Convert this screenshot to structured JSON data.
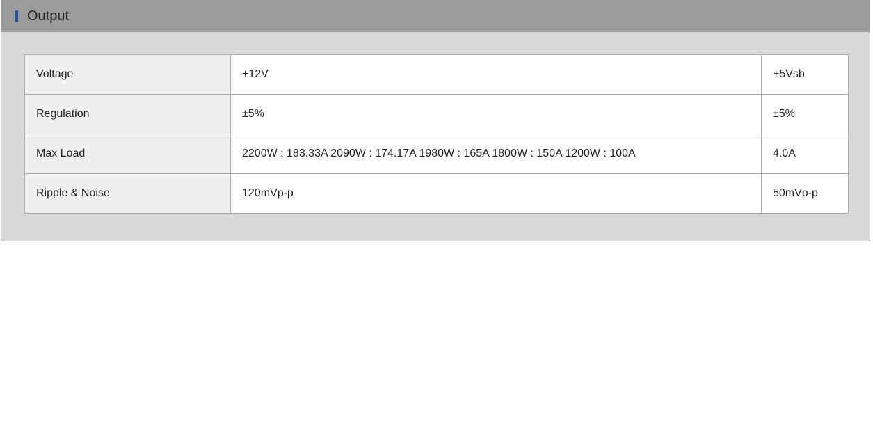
{
  "section": {
    "title": "Output",
    "accent_color": "#1f4fa3"
  },
  "table": {
    "rows": [
      {
        "label": "Voltage",
        "v12": "+12V",
        "v5sb": "+5Vsb"
      },
      {
        "label": "Regulation",
        "v12": "±5%",
        "v5sb": "±5%"
      },
      {
        "label": "Max Load",
        "v12": "2200W : 183.33A 2090W : 174.17A 1980W : 165A 1800W : 150A 1200W : 100A",
        "v5sb": "4.0A"
      },
      {
        "label": "Ripple & Noise",
        "v12": "120mVp-p",
        "v5sb": "50mVp-p"
      }
    ]
  }
}
